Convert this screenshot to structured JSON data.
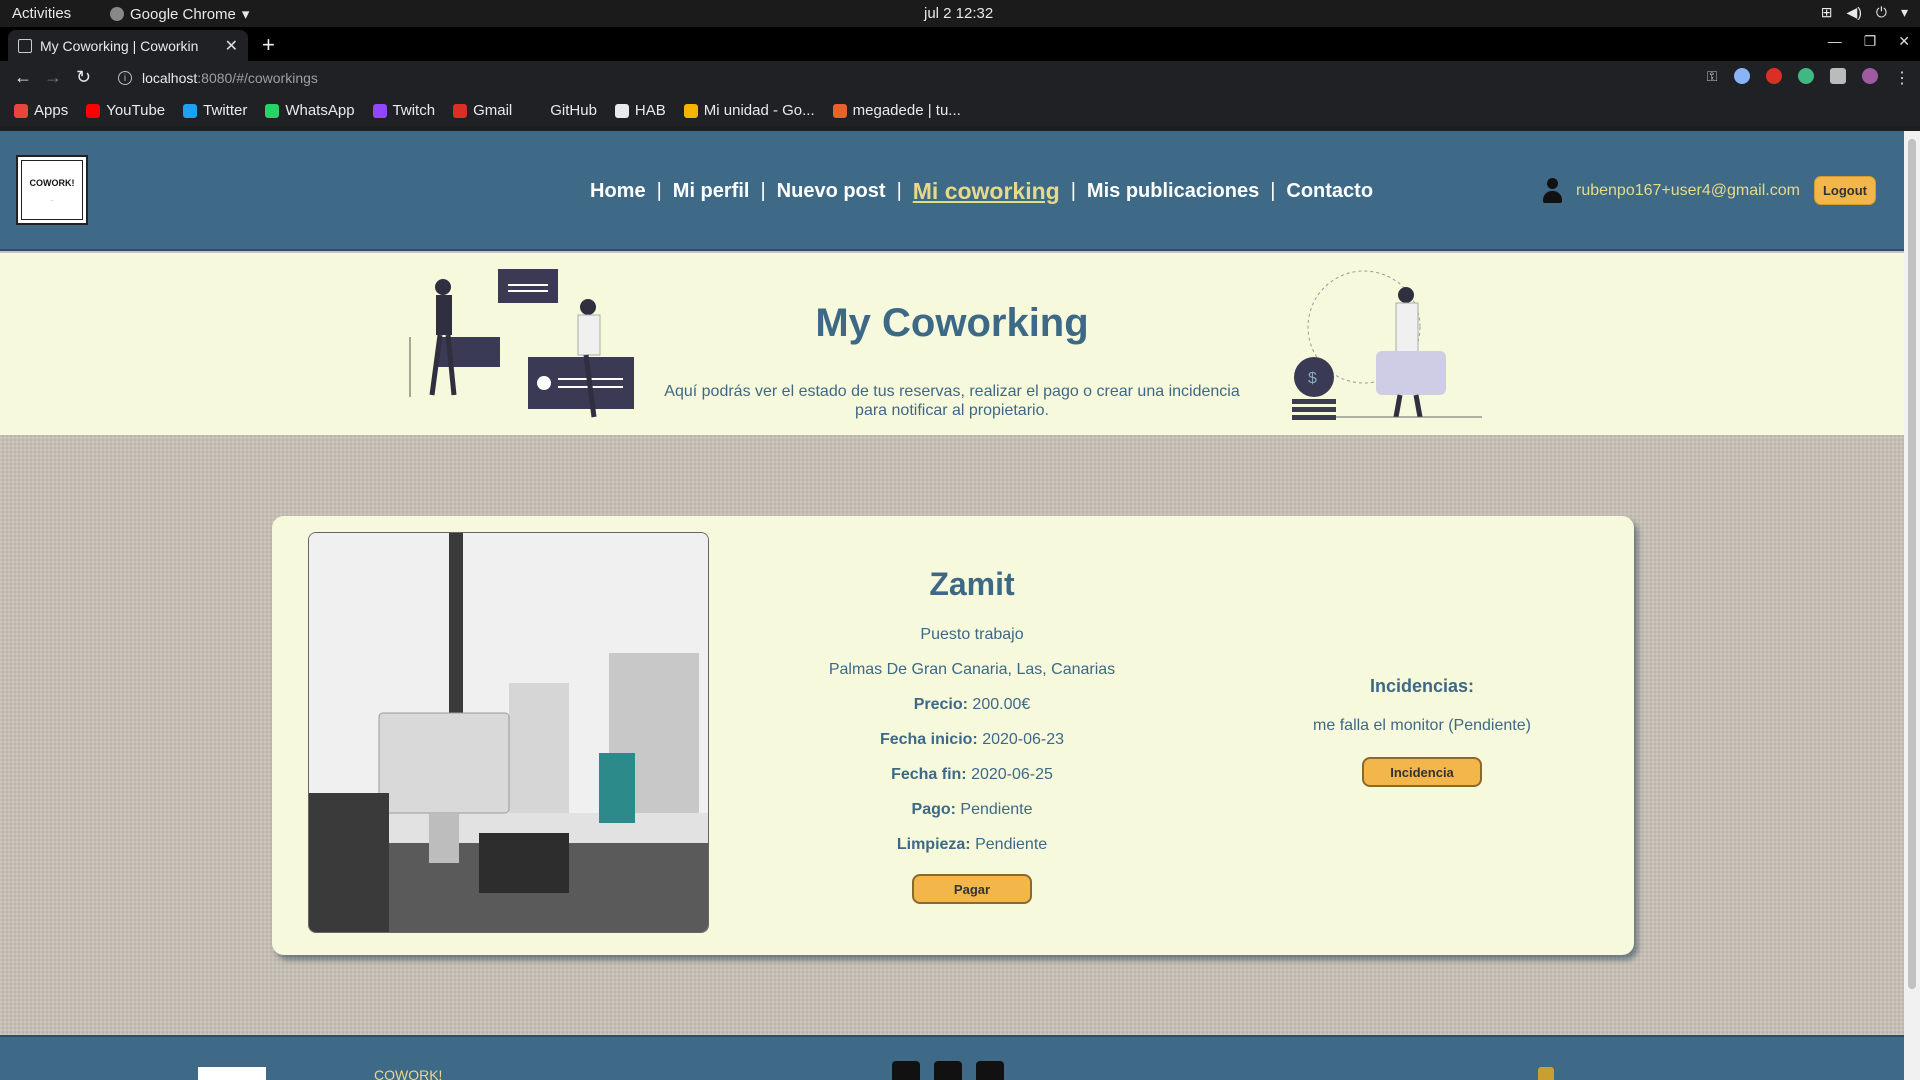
{
  "os": {
    "activities": "Activities",
    "app_name": "Google Chrome",
    "clock": "jul 2  12:32"
  },
  "browser": {
    "tab_title": "My Coworking | Coworkin",
    "url_host": "localhost",
    "url_path": ":8080/#/coworkings",
    "bookmarks": [
      {
        "label": "Apps",
        "icon": "apps-grid-icon",
        "color": "#e8453c"
      },
      {
        "label": "YouTube",
        "icon": "youtube-icon",
        "color": "#ff0000"
      },
      {
        "label": "Twitter",
        "icon": "twitter-icon",
        "color": "#1da1f2"
      },
      {
        "label": "WhatsApp",
        "icon": "whatsapp-icon",
        "color": "#25d366"
      },
      {
        "label": "Twitch",
        "icon": "twitch-icon",
        "color": "#9146ff"
      },
      {
        "label": "Gmail",
        "icon": "gmail-icon",
        "color": "#d93025"
      },
      {
        "label": "GitHub",
        "icon": "github-icon",
        "color": "#202124"
      },
      {
        "label": "HAB",
        "icon": "folder-icon",
        "color": "#e8eaed"
      },
      {
        "label": "Mi unidad - Go...",
        "icon": "drive-icon",
        "color": "#f4b400"
      },
      {
        "label": "megadede | tu...",
        "icon": "megadede-icon",
        "color": "#e8622c"
      }
    ]
  },
  "site": {
    "logo_text": "COWORK!",
    "nav": [
      {
        "label": "Home",
        "active": false
      },
      {
        "label": "Mi perfil",
        "active": false
      },
      {
        "label": "Nuevo post",
        "active": false
      },
      {
        "label": "Mi coworking",
        "active": true
      },
      {
        "label": "Mis publicaciones",
        "active": false
      },
      {
        "label": "Contacto",
        "active": false
      }
    ],
    "user_email": "rubenpo167+user4@gmail.com",
    "logout_label": "Logout",
    "colors": {
      "header": "#3e6a88",
      "accent": "#e6d98a",
      "button": "#f2b64a",
      "panel": "#f7f9dc"
    }
  },
  "hero": {
    "title": "My Coworking",
    "description": "Aquí podrás ver el estado de tus reservas, realizar el pago o crear una incidencia para notificar al propietario."
  },
  "booking": {
    "name": "Zamit",
    "type": "Puesto trabajo",
    "location": "Palmas De Gran Canaria, Las, Canarias",
    "price_label": "Precio:",
    "price": "200.00€",
    "start_label": "Fecha inicio:",
    "start": "2020-06-23",
    "end_label": "Fecha fin:",
    "end": "2020-06-25",
    "payment_label": "Pago:",
    "payment": "Pendiente",
    "cleaning_label": "Limpieza:",
    "cleaning": "Pendiente",
    "pay_button": "Pagar",
    "incidents_title": "Incidencias:",
    "incidents": [
      "me falla el monitor (Pendiente)"
    ],
    "incident_button": "Incidencia"
  },
  "footer": {
    "brand": "COWORK!"
  }
}
